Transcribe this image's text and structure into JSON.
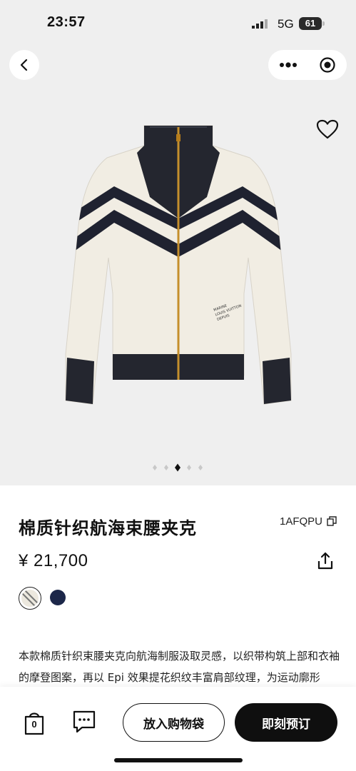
{
  "status_bar": {
    "time": "23:57",
    "network": "5G",
    "battery": "61"
  },
  "product": {
    "title": "棉质针织航海束腰夹克",
    "sku": "1AFQPU",
    "price": "¥ 21,700",
    "image_embroidery": "MARINE LOUIS VUITTON DEPUIS",
    "colors": [
      {
        "name": "white-striped",
        "hex": "#f1ede3",
        "selected": true
      },
      {
        "name": "navy",
        "hex": "#1c2749",
        "selected": false
      }
    ],
    "carousel": {
      "count": 5,
      "active": 3
    },
    "description": "本款棉质针织束腰夹克向航海制服汲取灵感，以织带构筑上部和衣袖的摩登图案，再以 Epi 效果提花织纹丰富肩部纹理，为运动廓形"
  },
  "actions": {
    "bag_count": "0",
    "add_to_cart": "放入购物袋",
    "buy_now": "即刻预订"
  },
  "icons": [
    "back-arrow-icon",
    "more-dots-icon",
    "capsule-close-icon",
    "heart-icon",
    "copy-icon",
    "share-icon",
    "bag-icon",
    "chat-icon"
  ]
}
